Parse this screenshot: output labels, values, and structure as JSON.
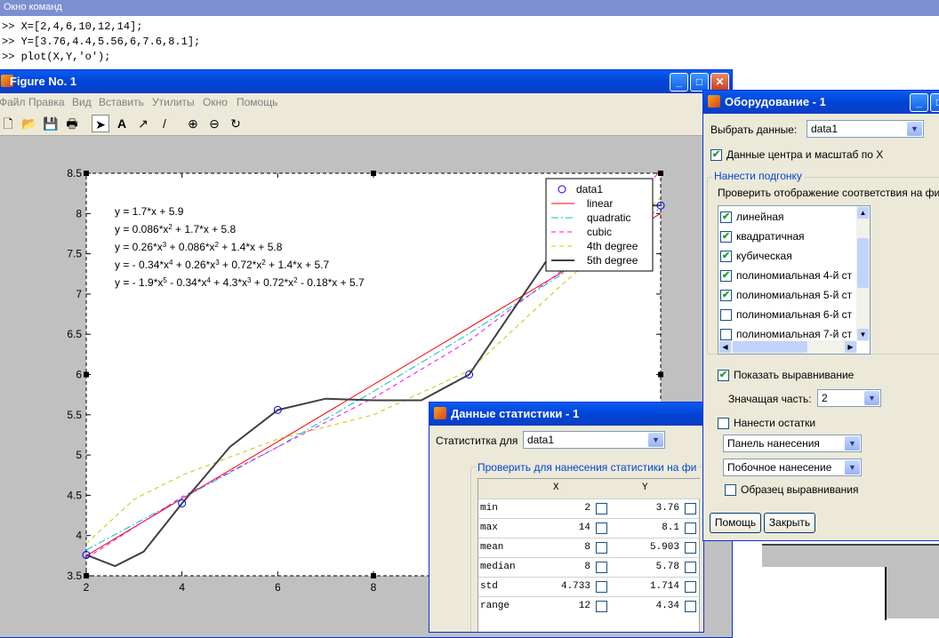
{
  "command_window": {
    "title": "Окно команд",
    "lines": [
      ">> X=[2,4,6,10,12,14];",
      ">> Y=[3.76,4.4,5.56,6,7.6,8.1];",
      ">> plot(X,Y,'o');"
    ]
  },
  "figure": {
    "title": "Figure No. 1",
    "menu": [
      "Файл",
      "Правка",
      "Вид",
      "Вставить",
      "Утилиты",
      "Окно",
      "Помощь"
    ],
    "toolbar_icons": [
      "new-file-icon",
      "open-folder-icon",
      "save-icon",
      "print-icon",
      "select-arrow-icon",
      "text-icon",
      "arrow-icon",
      "line-icon",
      "zoom-in-icon",
      "zoom-out-icon",
      "rotate-icon"
    ],
    "equations": [
      "y = 1.7*x + 5.9",
      "y = 0.086*x^2 + 1.7*x + 5.8",
      "y = 0.26*x^3 + 0.086*x^2 + 1.4*x + 5.8",
      "y = - 0.34*x^4 + 0.26*x^3 + 0.72*x^2 + 1.4*x + 5.7",
      "y = - 1.9*x^5 - 0.34*x^4 + 4.3*x^3 + 0.72*x^2 - 0.18*x + 5.7"
    ]
  },
  "chart_data": {
    "type": "line",
    "xlim": [
      2,
      14
    ],
    "ylim": [
      3.5,
      8.5
    ],
    "x_ticks": [
      "2",
      "4",
      "6",
      "8"
    ],
    "y_ticks": [
      "3.5",
      "4",
      "4.5",
      "5",
      "5.5",
      "6",
      "6.5",
      "7",
      "7.5",
      "8",
      "8.5"
    ],
    "legend_position": "top-right",
    "series": [
      {
        "name": "data1",
        "style": "marker",
        "color": "#0000ff",
        "x": [
          2,
          4,
          6,
          10,
          12,
          14
        ],
        "y": [
          3.76,
          4.4,
          5.56,
          6,
          7.6,
          8.1
        ]
      },
      {
        "name": "linear",
        "style": "solid",
        "color": "#ff0000",
        "x": [
          2,
          14
        ],
        "y": [
          3.75,
          8.0
        ]
      },
      {
        "name": "quadratic",
        "style": "dashdot",
        "color": "#00c0c0",
        "x": [
          2,
          4,
          6,
          8,
          10,
          12,
          14
        ],
        "y": [
          3.82,
          4.46,
          5.1,
          5.79,
          6.51,
          7.27,
          8.07
        ]
      },
      {
        "name": "cubic",
        "style": "dashed",
        "color": "#ff00ff",
        "x": [
          2,
          4,
          6,
          8,
          10,
          12,
          14
        ],
        "y": [
          3.72,
          4.48,
          5.1,
          5.71,
          6.42,
          7.32,
          8.53
        ]
      },
      {
        "name": "4th degree",
        "style": "dashed",
        "color": "#c8c800",
        "x": [
          2,
          3,
          4,
          6,
          8,
          10,
          12,
          14
        ],
        "y": [
          3.9,
          4.45,
          4.75,
          5.2,
          5.5,
          6.05,
          7.15,
          8.2
        ]
      },
      {
        "name": "5th degree",
        "style": "solid",
        "color": "#404040",
        "x": [
          2,
          2.6,
          3.2,
          4,
          5,
          6,
          7,
          8,
          9,
          10,
          10.8,
          11.6,
          12.4,
          13.2,
          14
        ],
        "y": [
          3.76,
          3.62,
          3.8,
          4.4,
          5.1,
          5.56,
          5.7,
          5.68,
          5.68,
          6.0,
          6.7,
          7.4,
          7.9,
          8.1,
          8.1
        ]
      }
    ]
  },
  "fitting_window": {
    "title": "Оборудование - 1",
    "select_label": "Выбрать данные:",
    "select_value": "data1",
    "center_scale_label": "Данные центра и масштаб по X",
    "group_title": "Нанести подгонку",
    "check_label": "Проверить отображение соответствия на фи",
    "fits": [
      {
        "label": "линейная",
        "checked": true
      },
      {
        "label": "квадратичная",
        "checked": true
      },
      {
        "label": "кубическая",
        "checked": true
      },
      {
        "label": "полиномиальная 4-й ст",
        "checked": true
      },
      {
        "label": "полиномиальная 5-й ст",
        "checked": true
      },
      {
        "label": "полиномиальная 6-й ст",
        "checked": false
      },
      {
        "label": "полиномиальная 7-й ст",
        "checked": false
      }
    ],
    "show_equations_label": "Показать выравнивание",
    "significant_label": "Значащая часть:",
    "significant_value": "2",
    "residuals_label": "Нанести остатки",
    "residual_plot_value": "Панель нанесения",
    "residual_side_value": "Побочное нанесение",
    "norm_label": "Образец выравнивания",
    "help_button": "Помощь",
    "close_button": "Закрыть"
  },
  "stats_window": {
    "title": "Данные статистики - 1",
    "stat_label": "Статиститка для",
    "stat_value": "data1",
    "group_title": "Проверить для нанесения статистики на фи",
    "columns": [
      "X",
      "Y"
    ],
    "rows": [
      {
        "name": "min",
        "x": "2",
        "y": "3.76"
      },
      {
        "name": "max",
        "x": "14",
        "y": "8.1"
      },
      {
        "name": "mean",
        "x": "8",
        "y": "5.903"
      },
      {
        "name": "median",
        "x": "8",
        "y": "5.78"
      },
      {
        "name": "std",
        "x": "4.733",
        "y": "1.714"
      },
      {
        "name": "range",
        "x": "12",
        "y": "4.34"
      }
    ]
  }
}
